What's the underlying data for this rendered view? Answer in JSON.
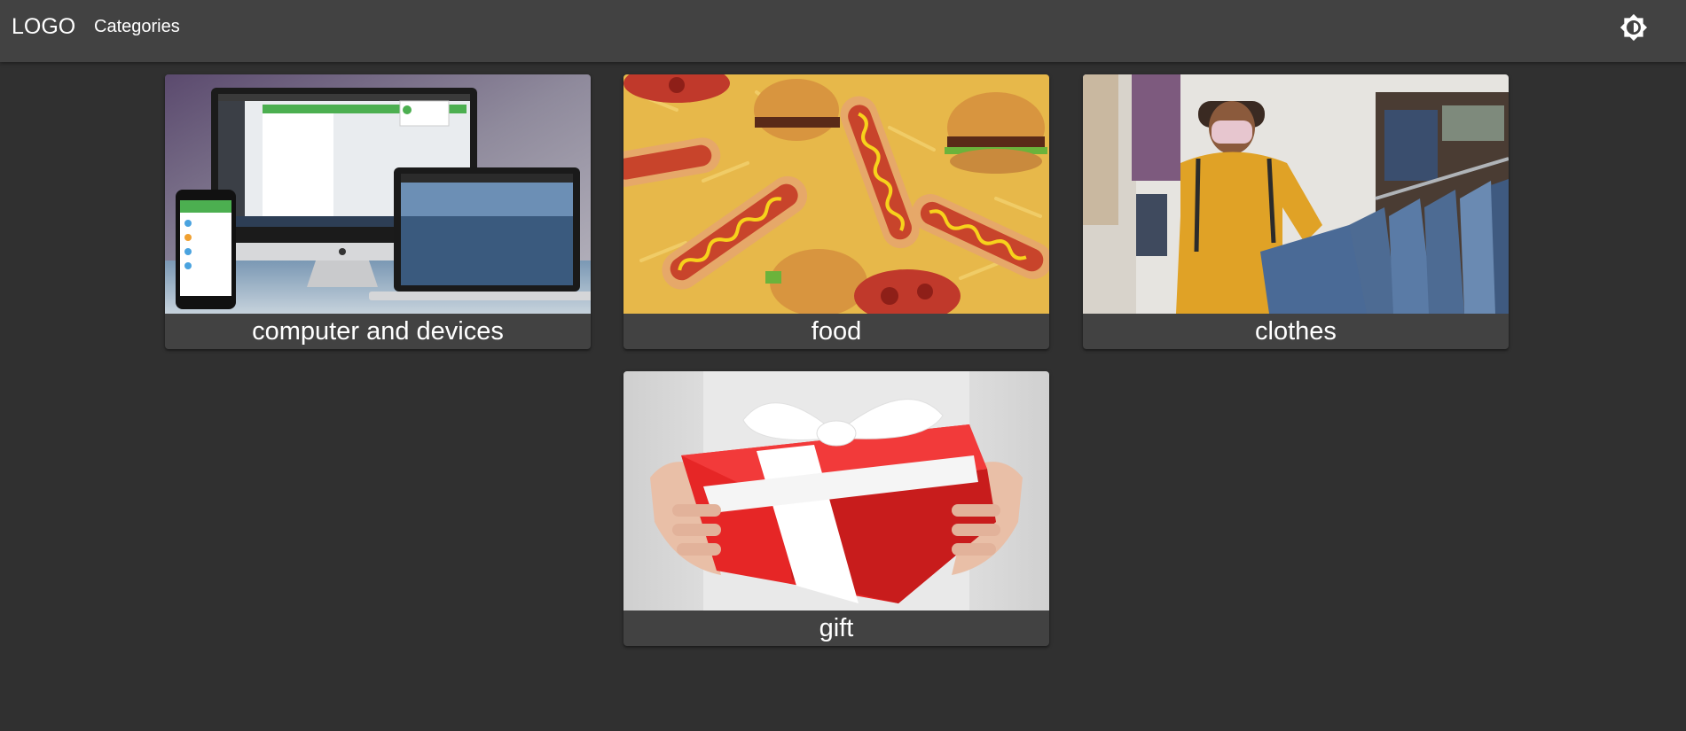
{
  "header": {
    "logo": "LOGO",
    "nav": {
      "categories_label": "Categories"
    },
    "theme_toggle_icon": "brightness-icon"
  },
  "categories": [
    {
      "label": "computer and devices",
      "image": "computer-and-devices-image"
    },
    {
      "label": "food",
      "image": "food-image"
    },
    {
      "label": "clothes",
      "image": "clothes-image"
    },
    {
      "label": "gift",
      "image": "gift-image"
    }
  ],
  "colors": {
    "background": "#303030",
    "appbar": "#424242",
    "card": "#424242",
    "text": "#ffffff"
  }
}
